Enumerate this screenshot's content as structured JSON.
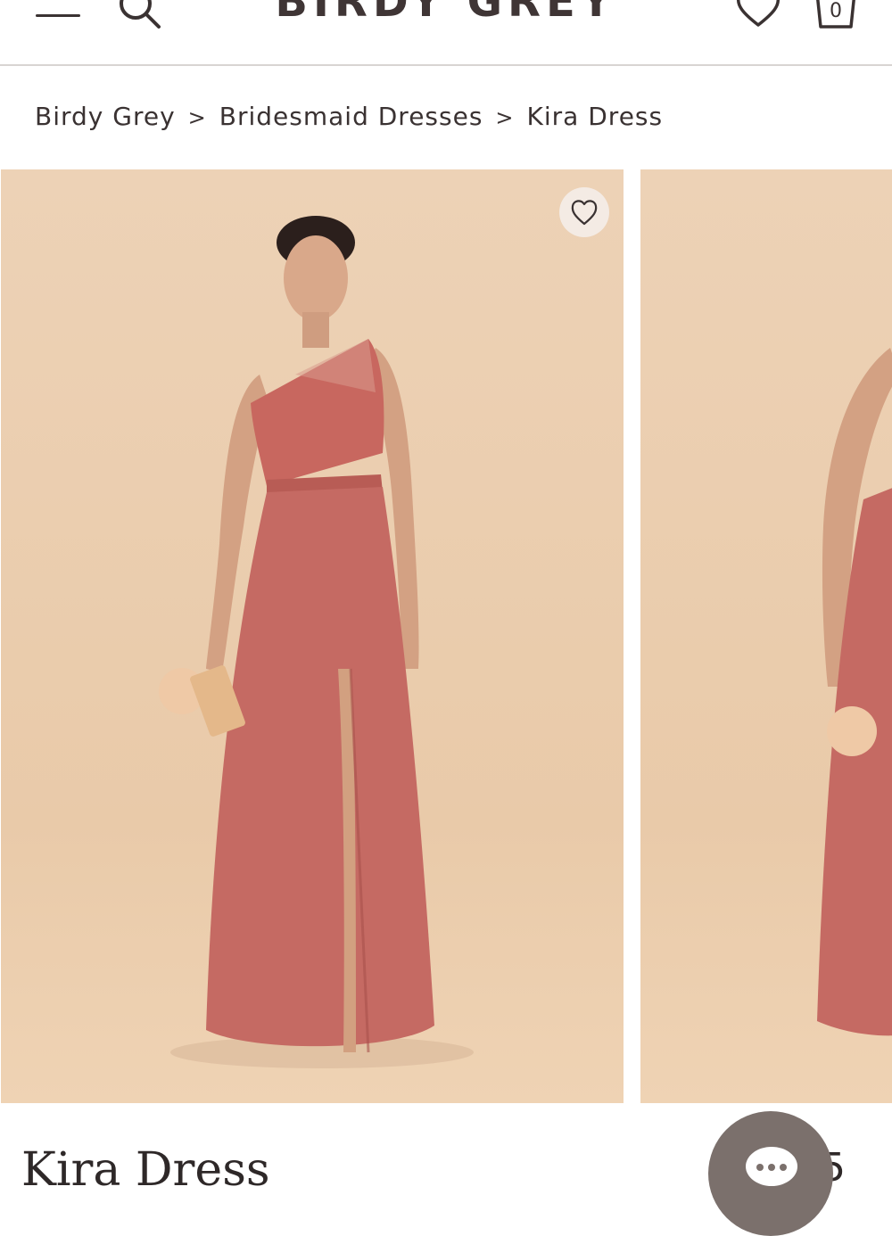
{
  "header": {
    "logo": "BIRDY GREY",
    "bag_count": "0",
    "icons": [
      "menu-icon",
      "search-icon",
      "heart-icon",
      "bag-icon"
    ]
  },
  "breadcrumb": {
    "items": [
      "Birdy Grey",
      "Bridesmaid Dresses",
      "Kira Dress"
    ],
    "separator": ">"
  },
  "product": {
    "title": "Kira Dress",
    "price_partial": "5",
    "dress_color": "#c56a63",
    "background_color": "#ebcbad"
  },
  "chat": {
    "icon": "chat-icon"
  }
}
